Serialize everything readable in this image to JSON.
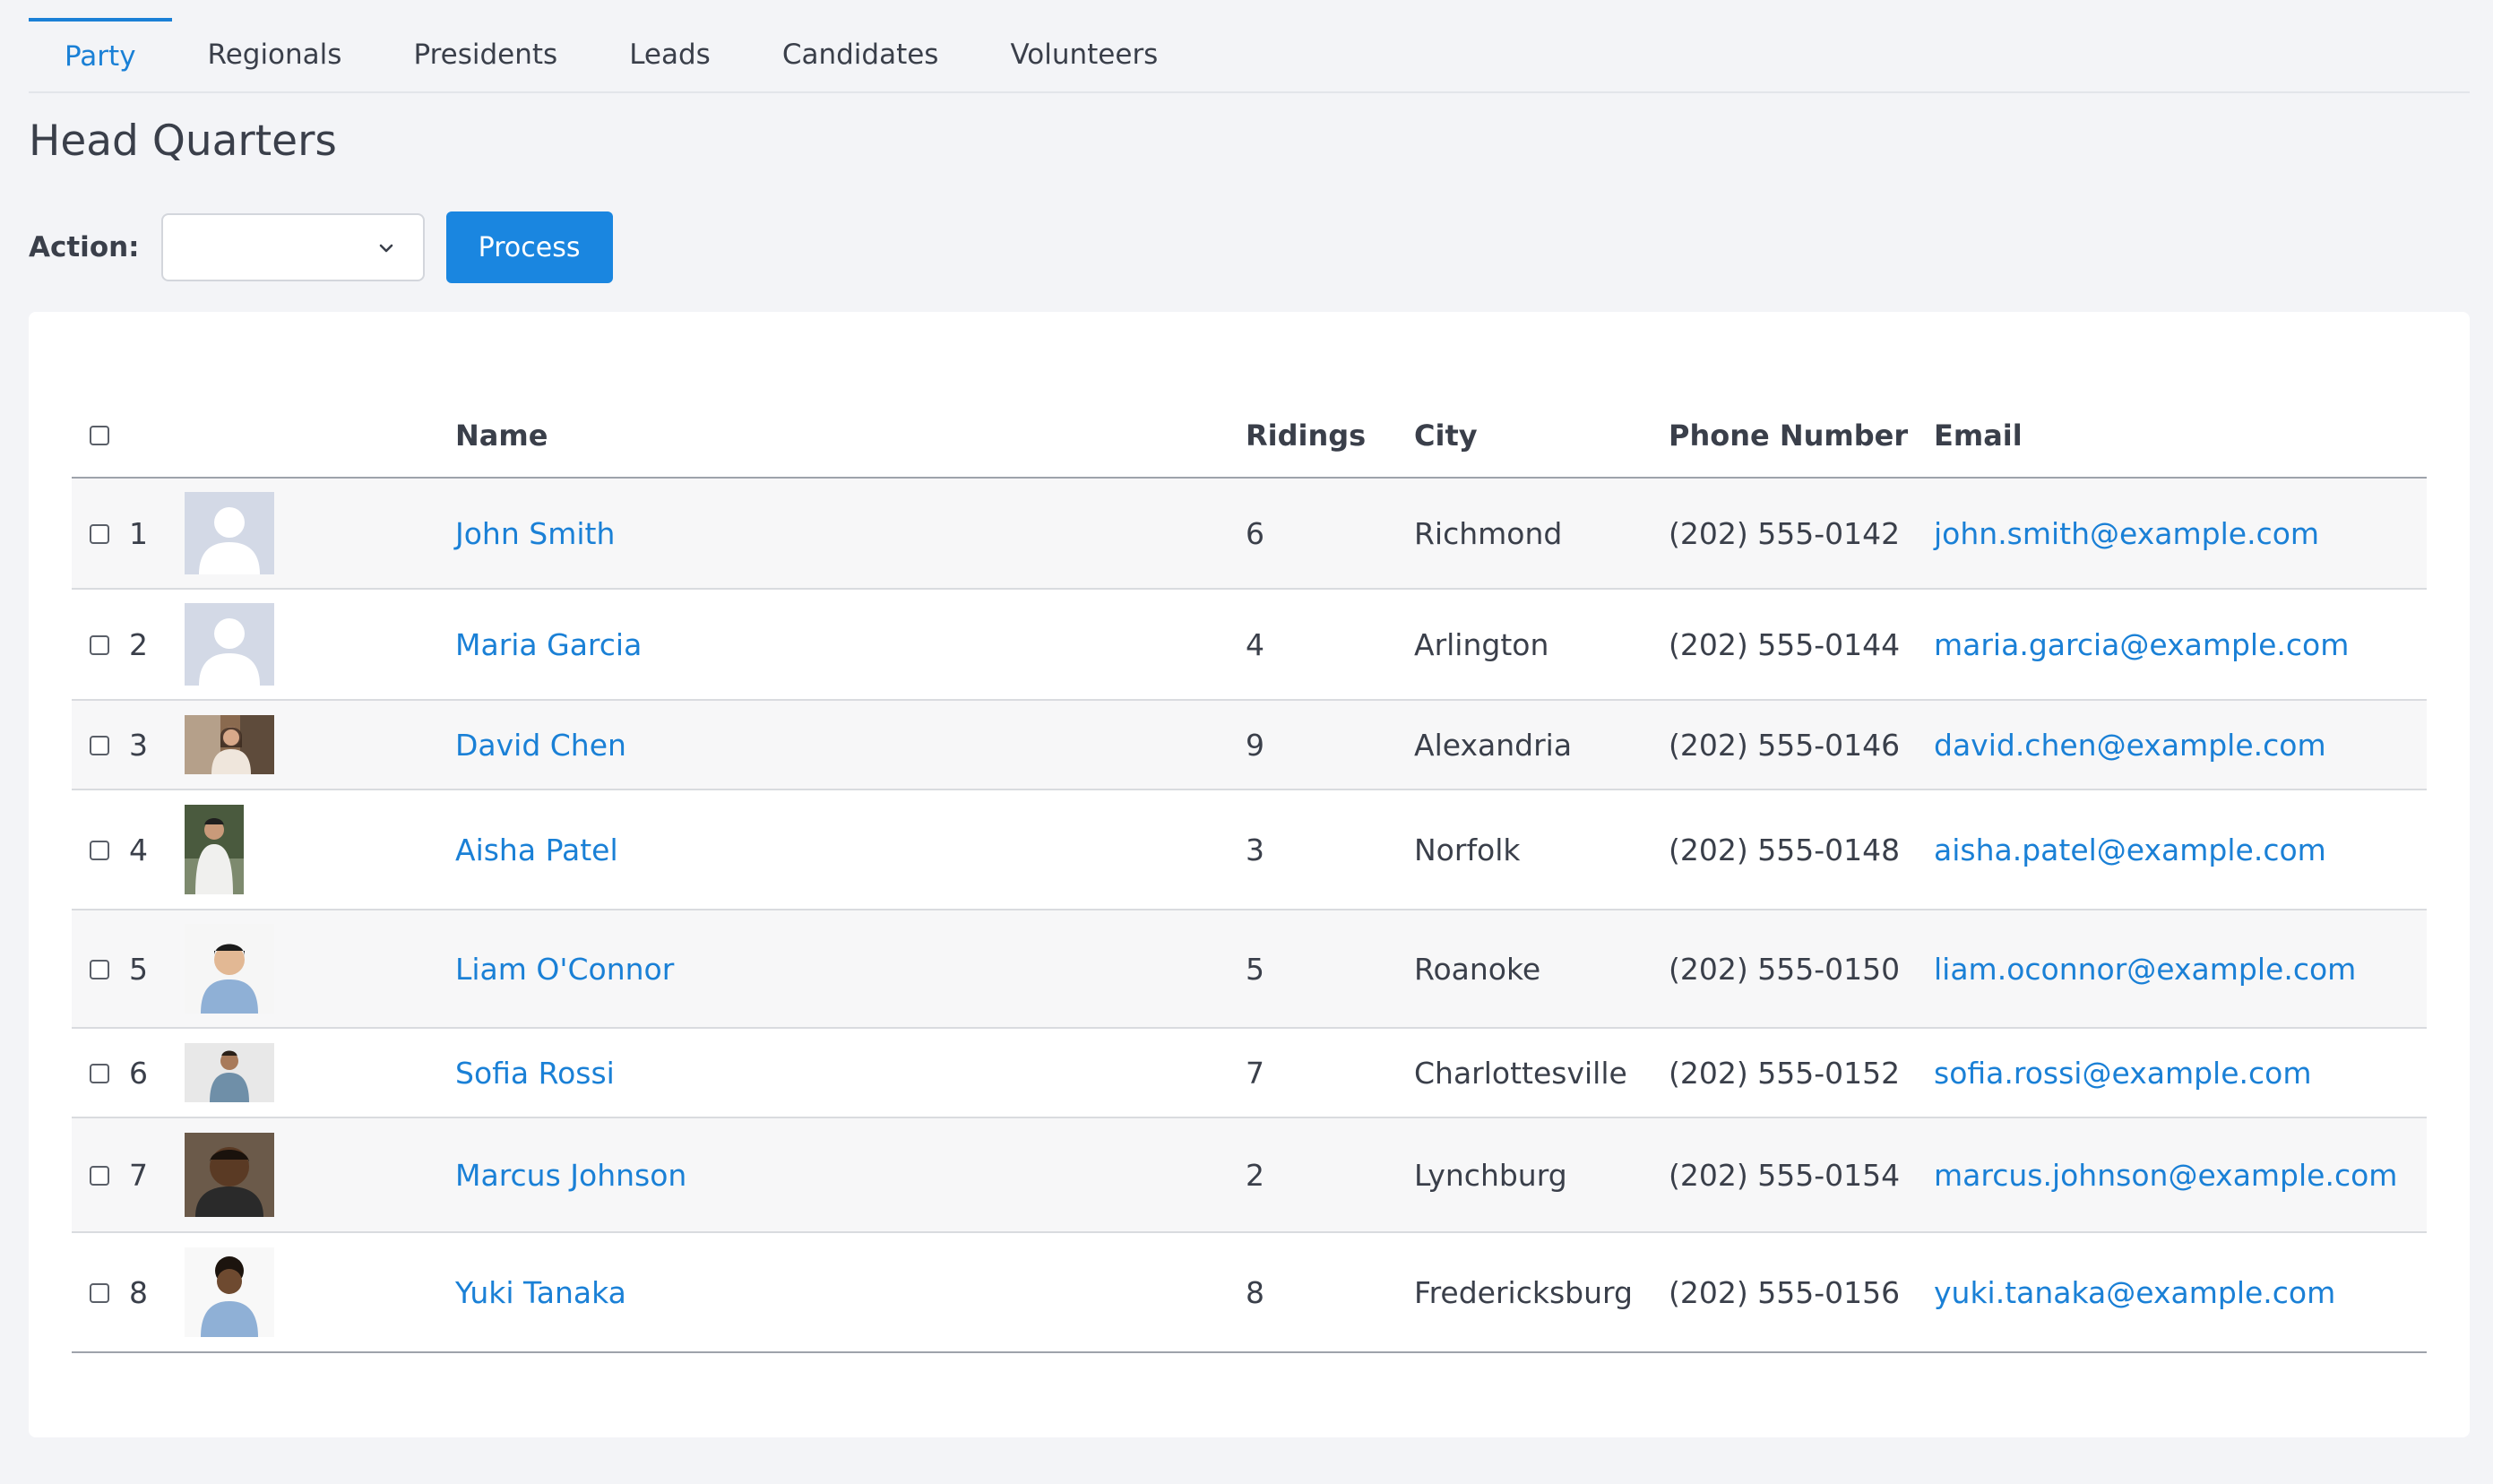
{
  "tabs": [
    {
      "label": "Party",
      "active": true
    },
    {
      "label": "Regionals",
      "active": false
    },
    {
      "label": "Presidents",
      "active": false
    },
    {
      "label": "Leads",
      "active": false
    },
    {
      "label": "Candidates",
      "active": false
    },
    {
      "label": "Volunteers",
      "active": false
    }
  ],
  "page_title": "Head Quarters",
  "action": {
    "label": "Action:",
    "selected": "",
    "process_label": "Process"
  },
  "table": {
    "headers": {
      "name": "Name",
      "ridings": "Ridings",
      "city": "City",
      "phone": "Phone Number",
      "email": "Email"
    },
    "rows": [
      {
        "num": "1",
        "name": "John Smith",
        "ridings": "6",
        "city": "Richmond",
        "phone": "(202) 555-0142",
        "email": "john.smith@example.com",
        "photo": "placeholder-avatar-icon"
      },
      {
        "num": "2",
        "name": "Maria Garcia",
        "ridings": "4",
        "city": "Arlington",
        "phone": "(202) 555-0144",
        "email": "maria.garcia@example.com",
        "photo": "placeholder-avatar-icon"
      },
      {
        "num": "3",
        "name": "David Chen",
        "ridings": "9",
        "city": "Alexandria",
        "phone": "(202) 555-0146",
        "email": "david.chen@example.com",
        "photo": "profile-photo"
      },
      {
        "num": "4",
        "name": "Aisha Patel",
        "ridings": "3",
        "city": "Norfolk",
        "phone": "(202) 555-0148",
        "email": "aisha.patel@example.com",
        "photo": "profile-photo"
      },
      {
        "num": "5",
        "name": "Liam O'Connor",
        "ridings": "5",
        "city": "Roanoke",
        "phone": "(202) 555-0150",
        "email": "liam.oconnor@example.com",
        "photo": "profile-photo"
      },
      {
        "num": "6",
        "name": "Sofia Rossi",
        "ridings": "7",
        "city": "Charlottesville",
        "phone": "(202) 555-0152",
        "email": "sofia.rossi@example.com",
        "photo": "profile-photo"
      },
      {
        "num": "7",
        "name": "Marcus Johnson",
        "ridings": "2",
        "city": "Lynchburg",
        "phone": "(202) 555-0154",
        "email": "marcus.johnson@example.com",
        "photo": "profile-photo"
      },
      {
        "num": "8",
        "name": "Yuki Tanaka",
        "ridings": "8",
        "city": "Fredericksburg",
        "phone": "(202) 555-0156",
        "email": "yuki.tanaka@example.com",
        "photo": "profile-photo"
      }
    ]
  },
  "colors": {
    "accent": "#1a80d6",
    "button": "#1a86e0",
    "background": "#f3f4f7",
    "card": "#ffffff",
    "text": "#3a3f4a"
  }
}
